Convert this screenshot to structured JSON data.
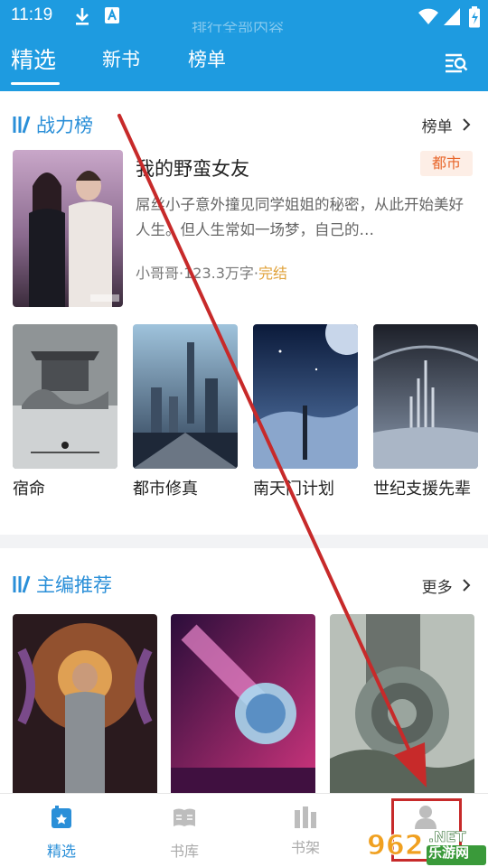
{
  "status": {
    "time": "11:19"
  },
  "ghost_text": "排行全部内容",
  "nav": {
    "tabs": [
      {
        "label": "精选",
        "active": true
      },
      {
        "label": "新书",
        "active": false
      },
      {
        "label": "榜单",
        "active": false
      }
    ]
  },
  "ranking": {
    "title": "战力榜",
    "more": "榜单",
    "featured": {
      "title": "我的野蛮女友",
      "tag": "都市",
      "description": "屌丝小子意外撞见同学姐姐的秘密，从此开始美好人生。但人生常如一场梦，自己的…",
      "author": "小哥哥",
      "words": "123.3万字",
      "status": "完结"
    },
    "books": [
      {
        "name": "宿命"
      },
      {
        "name": "都市修真"
      },
      {
        "name": "南天门计划"
      },
      {
        "name": "世纪支援先辈"
      }
    ]
  },
  "editor": {
    "title": "主编推荐",
    "more": "更多"
  },
  "bottom_nav": [
    {
      "label": "精选",
      "icon": "featured-icon",
      "active": true
    },
    {
      "label": "书库",
      "icon": "library-icon",
      "active": false
    },
    {
      "label": "书架",
      "icon": "bookshelf-icon",
      "active": false
    },
    {
      "label": "",
      "icon": "profile-icon",
      "active": false
    }
  ],
  "watermark": {
    "text": "乐游网"
  },
  "colors": {
    "primary": "#1e9be0",
    "accent": "#2a8fd8",
    "tag": "#e8662b",
    "annotation": "#c72a2a"
  }
}
